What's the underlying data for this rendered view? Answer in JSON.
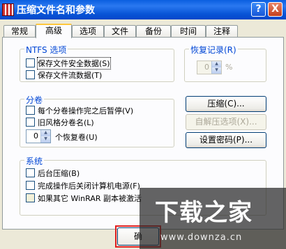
{
  "window": {
    "title": "压缩文件名和参数",
    "help_label": "?",
    "close_label": "X"
  },
  "tabs": [
    "常规",
    "高级",
    "选项",
    "文件",
    "备份",
    "时间",
    "注释"
  ],
  "ntfs": {
    "label": "NTFS 选项",
    "items": [
      "保存文件安全数据(S)",
      "保存文件流数据(T)"
    ]
  },
  "recovery": {
    "label": "恢复记录(R)",
    "value": "0",
    "unit": "%"
  },
  "volumes": {
    "label": "分卷",
    "items": [
      "每个分卷操作完之后暂停(V)",
      "旧风格分卷名(L)"
    ],
    "spin_value": "0",
    "spin_label": "个恢复卷(U)"
  },
  "buttons": {
    "compress": "压缩(C)...",
    "sfx": "自解压选项(X)...",
    "password": "设置密码(P)..."
  },
  "system": {
    "label": "系统",
    "items": [
      "后台压缩(B)",
      "完成操作后关闭计算机电源(F)",
      "如果其它 WinRAR 副本被激活"
    ]
  },
  "footer": {
    "ok_label": "确"
  },
  "watermark": {
    "text": "下载之家",
    "url": "www.downza.cn"
  }
}
